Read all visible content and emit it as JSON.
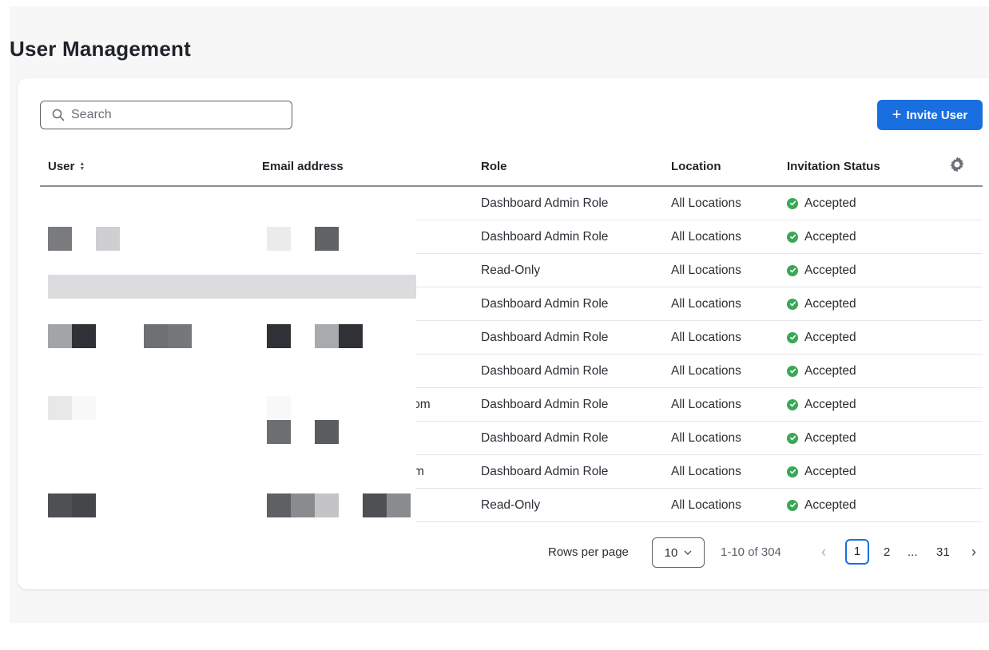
{
  "page": {
    "title": "User Management"
  },
  "toolbar": {
    "search_placeholder": "Search",
    "invite_label": "Invite User",
    "invite_plus": "+"
  },
  "table": {
    "columns": [
      {
        "label": "User",
        "sortable": true
      },
      {
        "label": "Email address"
      },
      {
        "label": "Role"
      },
      {
        "label": "Location"
      },
      {
        "label": "Invitation Status"
      }
    ],
    "rows": [
      {
        "email_tail": "",
        "role": "Dashboard Admin Role",
        "location": "All Locations",
        "status": "Accepted"
      },
      {
        "email_tail": "",
        "role": "Dashboard Admin Role",
        "location": "All Locations",
        "status": "Accepted"
      },
      {
        "email_tail": "",
        "role": "Read-Only",
        "location": "All Locations",
        "status": "Accepted"
      },
      {
        "email_tail": "",
        "role": "Dashboard Admin Role",
        "location": "All Locations",
        "status": "Accepted"
      },
      {
        "email_tail": "",
        "role": "Dashboard Admin Role",
        "location": "All Locations",
        "status": "Accepted"
      },
      {
        "email_tail": "",
        "role": "Dashboard Admin Role",
        "location": "All Locations",
        "status": "Accepted"
      },
      {
        "email_tail": "ɔm",
        "role": "Dashboard Admin Role",
        "location": "All Locations",
        "status": "Accepted"
      },
      {
        "email_tail": "",
        "role": "Dashboard Admin Role",
        "location": "All Locations",
        "status": "Accepted"
      },
      {
        "email_tail": "m",
        "role": "Dashboard Admin Role",
        "location": "All Locations",
        "status": "Accepted"
      },
      {
        "email_tail": "",
        "role": "Read-Only",
        "location": "All Locations",
        "status": "Accepted"
      }
    ]
  },
  "pagination": {
    "rows_per_page_label": "Rows per page",
    "rows_per_page_value": "10",
    "range": "1-10 of 304",
    "pages": [
      "1",
      "2",
      "...",
      "31"
    ],
    "current_page": "1"
  },
  "colors": {
    "accent": "#1a6fe0",
    "success": "#3aa856"
  },
  "icons": {
    "search": "search-icon",
    "settings": "gear-icon",
    "status": "check-circle-icon",
    "sort": "sort-icon"
  }
}
